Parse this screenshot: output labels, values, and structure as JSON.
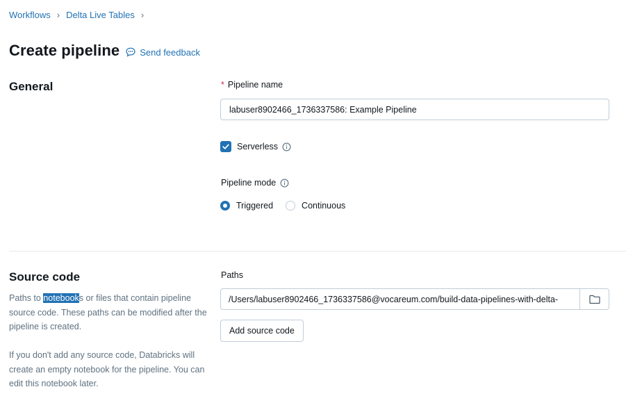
{
  "breadcrumb": {
    "items": [
      "Workflows",
      "Delta Live Tables"
    ],
    "separator": "›"
  },
  "header": {
    "title": "Create pipeline",
    "feedback_label": "Send feedback"
  },
  "general": {
    "heading": "General",
    "pipeline_name": {
      "required_marker": "*",
      "label": "Pipeline name",
      "value": "labuser8902466_1736337586: Example Pipeline"
    },
    "serverless": {
      "label": "Serverless",
      "checked": true
    },
    "pipeline_mode": {
      "label": "Pipeline mode",
      "options": [
        "Triggered",
        "Continuous"
      ],
      "selected": "Triggered"
    }
  },
  "source_code": {
    "heading": "Source code",
    "desc1_before": "Paths to ",
    "desc1_highlight": "notebook",
    "desc1_after": "s or files that contain pipeline source code. These paths can be modified after the pipeline is created.",
    "desc2": "If you don't add any source code, Databricks will create an empty notebook for the pipeline. You can edit this notebook later.",
    "paths_label": "Paths",
    "path_value": "/Users/labuser8902466_1736337586@vocareum.com/build-data-pipelines-with-delta-",
    "add_button": "Add source code"
  },
  "colors": {
    "link": "#2272b4",
    "accent": "#2272b4",
    "required": "#c82d4c",
    "border": "#c0cdd8",
    "muted_text": "#5f7281"
  },
  "icons": {
    "breadcrumb_separator": "chevron-right-icon",
    "feedback": "speech-bubble-icon",
    "info": "info-icon",
    "folder": "folder-icon",
    "checkbox": "check-icon"
  }
}
